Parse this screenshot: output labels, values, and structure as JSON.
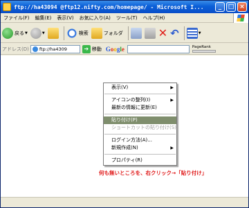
{
  "window": {
    "title": "ftp://ha43094  @ftp12.nifty.com/homepage/ - Microsoft I..."
  },
  "menubar": {
    "items": [
      "ファイル(F)",
      "編集(E)",
      "表示(V)",
      "お気に入り(A)",
      "ツール(T)",
      "ヘルプ(H)"
    ]
  },
  "toolbar": {
    "back_label": "戻る",
    "search_label": "検索",
    "folder_label": "フォルダ"
  },
  "address": {
    "label": "アドレス(D)",
    "value": "ftp://ha4309",
    "go_label": "移動",
    "google_logo": "Google",
    "pagerank_label": "PageRank"
  },
  "context_menu": {
    "items": [
      {
        "label": "表示(V)",
        "submenu": true
      },
      {
        "label": "アイコンの整列(I)",
        "submenu": true
      },
      {
        "label": "最新の情報に更新(E)"
      },
      {
        "label": "貼り付け(P)",
        "highlighted": true
      },
      {
        "label": "ショートカットの貼り付け(S)",
        "disabled": true
      },
      {
        "label": "ログイン方法(A)..."
      },
      {
        "label": "新規作成(N)",
        "submenu": true
      },
      {
        "label": "プロパティ(R)"
      }
    ]
  },
  "annotation": {
    "text": "何も無いところを、右クリック→「貼り付け」",
    "color": "#e01a1a"
  },
  "colors": {
    "titlebar": "#0a5fd8",
    "menu_highlight": "#7f8e6d"
  }
}
